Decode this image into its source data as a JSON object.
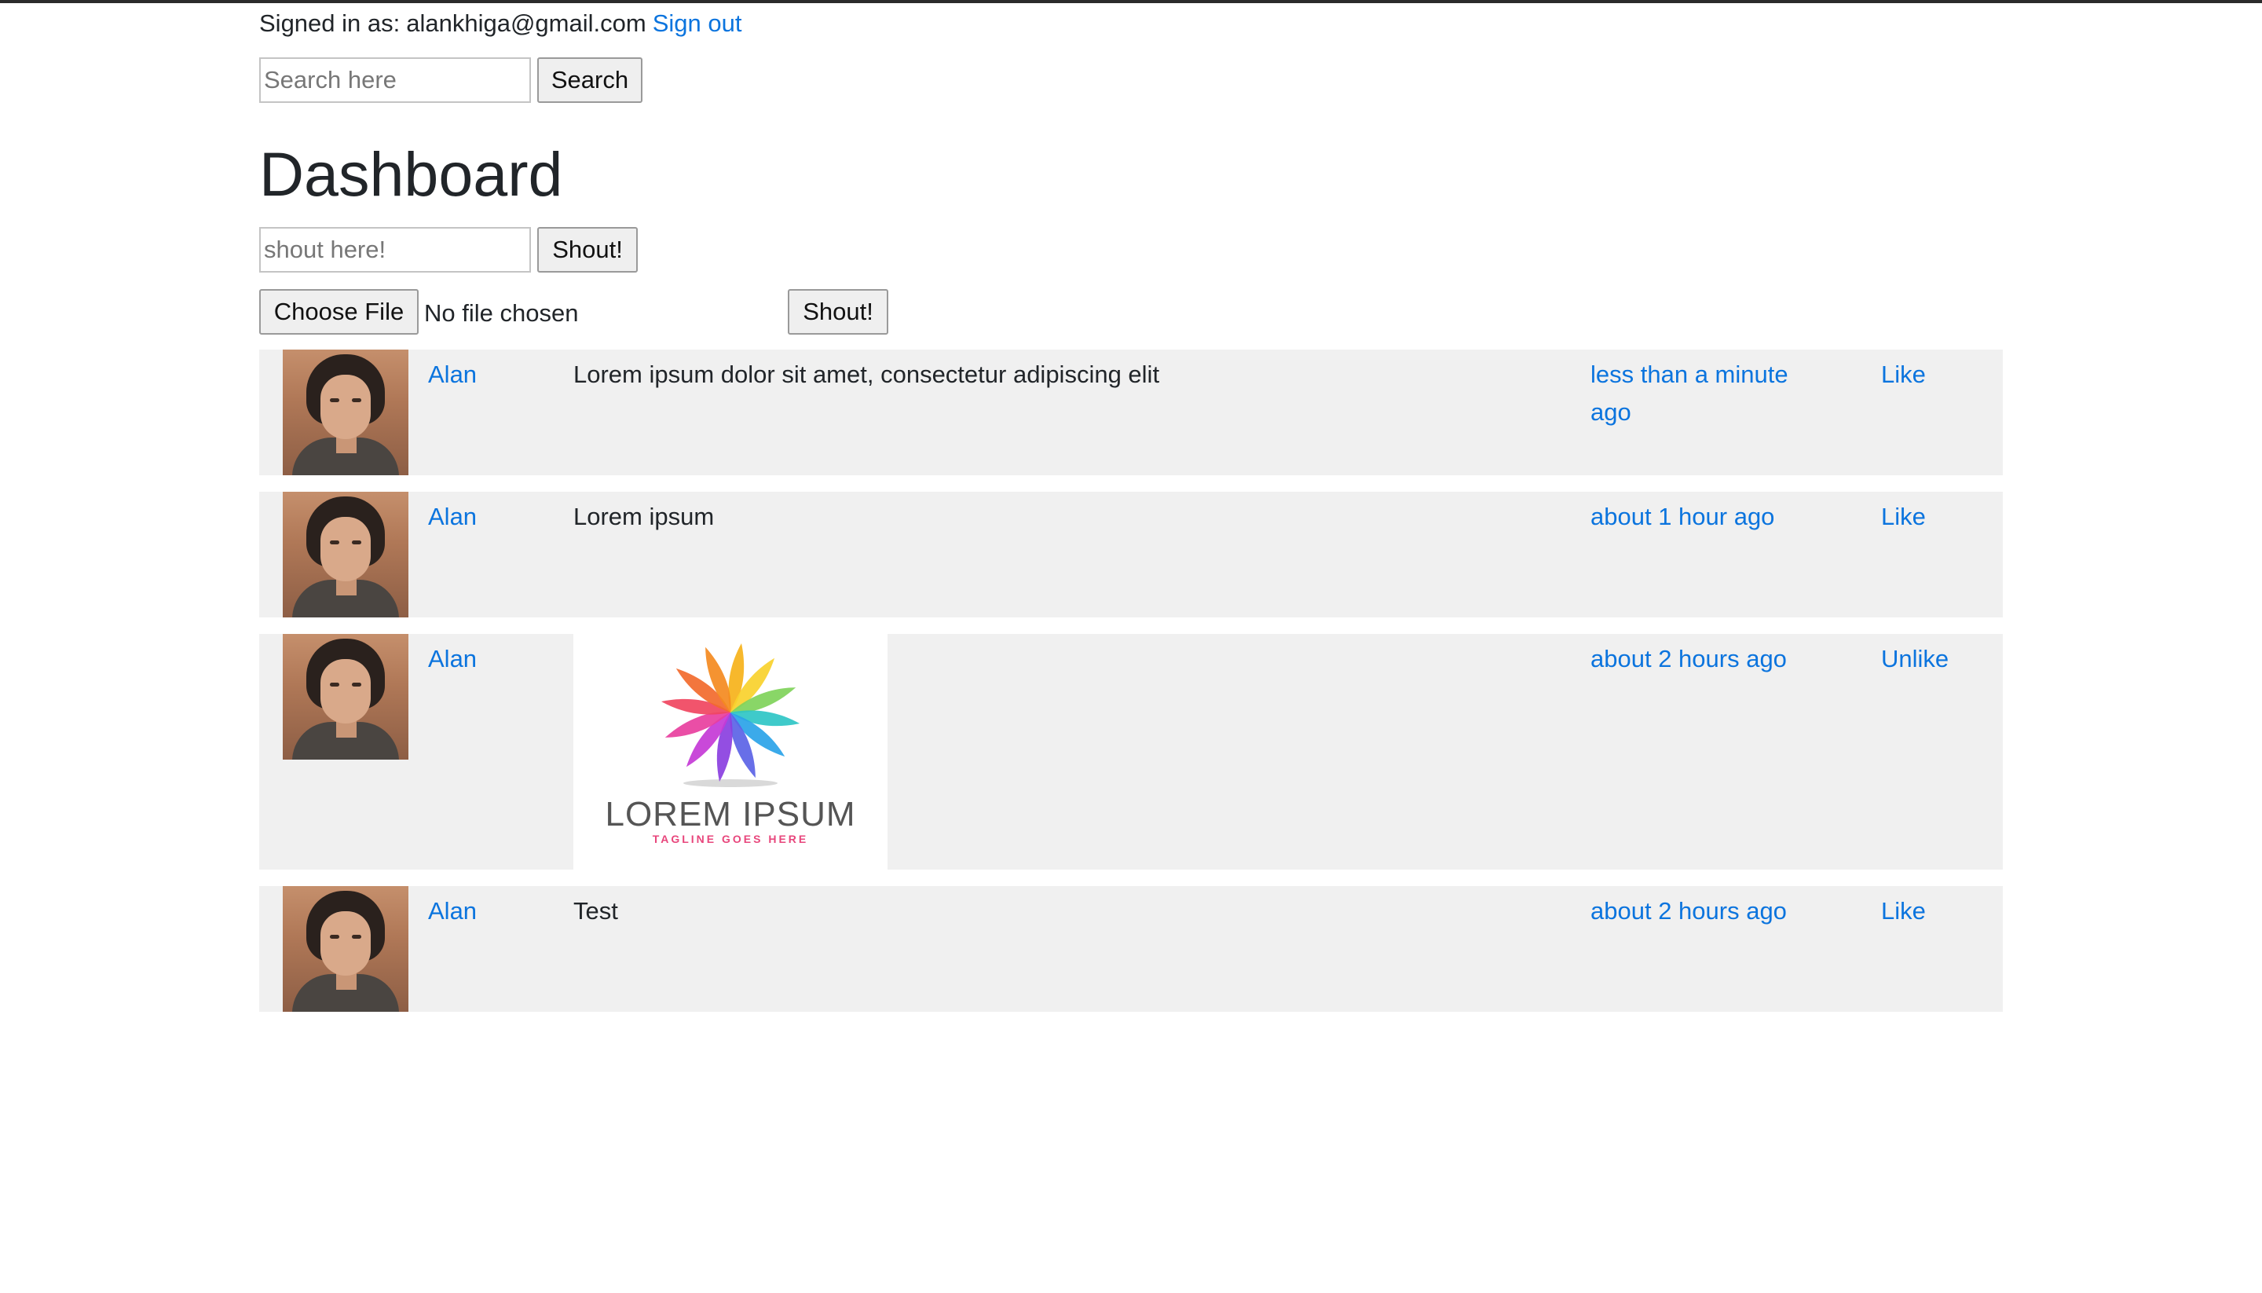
{
  "header": {
    "signed_in_label": "Signed in as:",
    "email": "alankhiga@gmail.com",
    "sign_out": "Sign out"
  },
  "search": {
    "placeholder": "Search here",
    "value": "",
    "button": "Search"
  },
  "page_title": "Dashboard",
  "text_shout": {
    "placeholder": "shout here!",
    "value": "",
    "button": "Shout!"
  },
  "photo_shout": {
    "choose_file": "Choose File",
    "file_status": "No file chosen",
    "button": "Shout!"
  },
  "image_shout_logo": {
    "title": "LOREM IPSUM",
    "tagline": "TAGLINE GOES HERE"
  },
  "shouts": [
    {
      "author": "Alan",
      "body": "Lorem ipsum dolor sit amet, consectetur adipiscing elit",
      "time": "less than a minute ago",
      "action": "Like"
    },
    {
      "author": "Alan",
      "body": "Lorem ipsum",
      "time": "about 1 hour ago",
      "action": "Like"
    },
    {
      "author": "Alan",
      "body": "",
      "time": "about 2 hours ago",
      "action": "Unlike"
    },
    {
      "author": "Alan",
      "body": "Test",
      "time": "about 2 hours ago",
      "action": "Like"
    }
  ],
  "colors": {
    "link": "#0b74de",
    "row_background": "#f0f0f0",
    "text": "#212529"
  }
}
